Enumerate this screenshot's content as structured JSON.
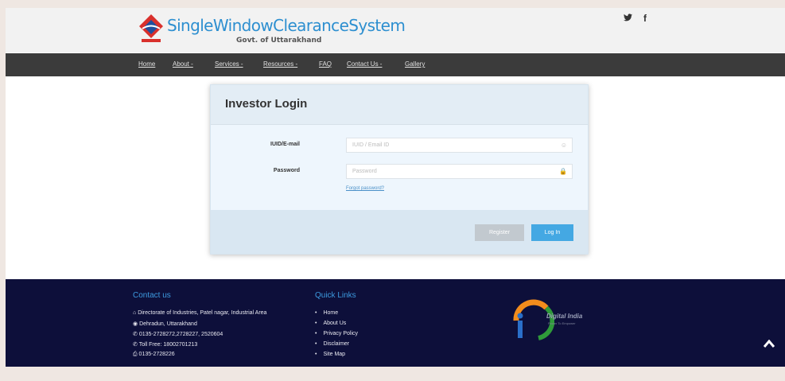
{
  "header": {
    "title": "SingleWindowClearanceSystem",
    "subtitle": "Govt. of Uttarakhand",
    "social": {
      "twitter": "🐦",
      "facebook": "f"
    }
  },
  "nav": {
    "items": [
      "Home",
      "About -",
      "Services -",
      "Resources -",
      "FAQ",
      "Contact Us -",
      "Gallery"
    ]
  },
  "login": {
    "title": "Investor Login",
    "iuid_label": "IUID/E-mail",
    "iuid_placeholder": "IUID / Email ID",
    "password_label": "Password",
    "password_placeholder": "Password",
    "forgot": "Forgot password?",
    "register": "Register",
    "login": "Log In"
  },
  "footer": {
    "contact_title": "Contact us",
    "contact_lines": [
      "Directorate of Industries, Patel nagar, Industrial Area",
      "Dehradun, Uttarakhand",
      "0135-2728272,2728227, 2520604",
      "Toll Free: 18002701213",
      "0135-2728226"
    ],
    "links_title": "Quick Links",
    "links": [
      "Home",
      "About Us",
      "Privacy Policy",
      "Disclaimer",
      "Site Map"
    ],
    "digital_india": "Digital India",
    "digital_india_sub": "Power To Empower"
  },
  "colors": {
    "nav": "#3b3b3b",
    "footer": "#0d0f3a",
    "accent": "#44a8e3",
    "brand": "#2d8fd0"
  }
}
